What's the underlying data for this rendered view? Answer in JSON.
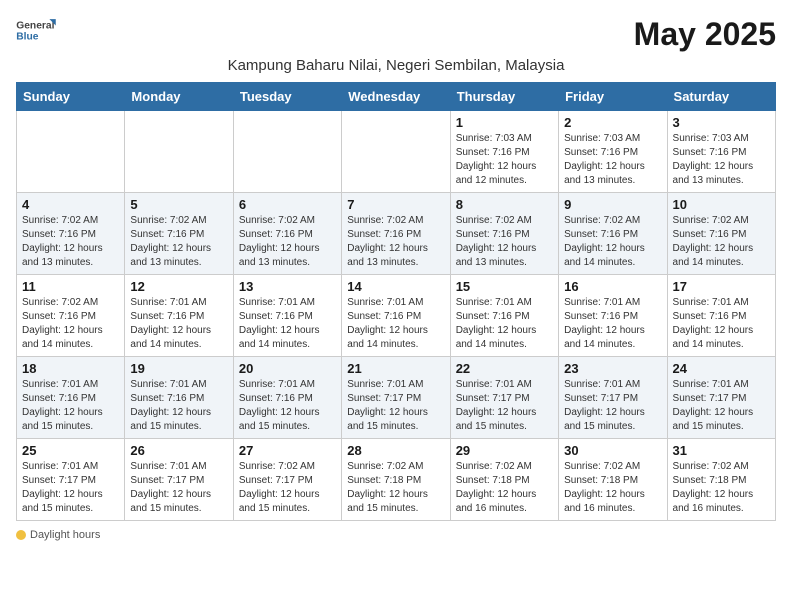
{
  "header": {
    "logo_general": "General",
    "logo_blue": "Blue",
    "month_title": "May 2025",
    "subtitle": "Kampung Baharu Nilai, Negeri Sembilan, Malaysia"
  },
  "days_of_week": [
    "Sunday",
    "Monday",
    "Tuesday",
    "Wednesday",
    "Thursday",
    "Friday",
    "Saturday"
  ],
  "weeks": [
    [
      {
        "day": "",
        "info": ""
      },
      {
        "day": "",
        "info": ""
      },
      {
        "day": "",
        "info": ""
      },
      {
        "day": "",
        "info": ""
      },
      {
        "day": "1",
        "info": "Sunrise: 7:03 AM\nSunset: 7:16 PM\nDaylight: 12 hours\nand 12 minutes."
      },
      {
        "day": "2",
        "info": "Sunrise: 7:03 AM\nSunset: 7:16 PM\nDaylight: 12 hours\nand 13 minutes."
      },
      {
        "day": "3",
        "info": "Sunrise: 7:03 AM\nSunset: 7:16 PM\nDaylight: 12 hours\nand 13 minutes."
      }
    ],
    [
      {
        "day": "4",
        "info": "Sunrise: 7:02 AM\nSunset: 7:16 PM\nDaylight: 12 hours\nand 13 minutes."
      },
      {
        "day": "5",
        "info": "Sunrise: 7:02 AM\nSunset: 7:16 PM\nDaylight: 12 hours\nand 13 minutes."
      },
      {
        "day": "6",
        "info": "Sunrise: 7:02 AM\nSunset: 7:16 PM\nDaylight: 12 hours\nand 13 minutes."
      },
      {
        "day": "7",
        "info": "Sunrise: 7:02 AM\nSunset: 7:16 PM\nDaylight: 12 hours\nand 13 minutes."
      },
      {
        "day": "8",
        "info": "Sunrise: 7:02 AM\nSunset: 7:16 PM\nDaylight: 12 hours\nand 13 minutes."
      },
      {
        "day": "9",
        "info": "Sunrise: 7:02 AM\nSunset: 7:16 PM\nDaylight: 12 hours\nand 14 minutes."
      },
      {
        "day": "10",
        "info": "Sunrise: 7:02 AM\nSunset: 7:16 PM\nDaylight: 12 hours\nand 14 minutes."
      }
    ],
    [
      {
        "day": "11",
        "info": "Sunrise: 7:02 AM\nSunset: 7:16 PM\nDaylight: 12 hours\nand 14 minutes."
      },
      {
        "day": "12",
        "info": "Sunrise: 7:01 AM\nSunset: 7:16 PM\nDaylight: 12 hours\nand 14 minutes."
      },
      {
        "day": "13",
        "info": "Sunrise: 7:01 AM\nSunset: 7:16 PM\nDaylight: 12 hours\nand 14 minutes."
      },
      {
        "day": "14",
        "info": "Sunrise: 7:01 AM\nSunset: 7:16 PM\nDaylight: 12 hours\nand 14 minutes."
      },
      {
        "day": "15",
        "info": "Sunrise: 7:01 AM\nSunset: 7:16 PM\nDaylight: 12 hours\nand 14 minutes."
      },
      {
        "day": "16",
        "info": "Sunrise: 7:01 AM\nSunset: 7:16 PM\nDaylight: 12 hours\nand 14 minutes."
      },
      {
        "day": "17",
        "info": "Sunrise: 7:01 AM\nSunset: 7:16 PM\nDaylight: 12 hours\nand 14 minutes."
      }
    ],
    [
      {
        "day": "18",
        "info": "Sunrise: 7:01 AM\nSunset: 7:16 PM\nDaylight: 12 hours\nand 15 minutes."
      },
      {
        "day": "19",
        "info": "Sunrise: 7:01 AM\nSunset: 7:16 PM\nDaylight: 12 hours\nand 15 minutes."
      },
      {
        "day": "20",
        "info": "Sunrise: 7:01 AM\nSunset: 7:16 PM\nDaylight: 12 hours\nand 15 minutes."
      },
      {
        "day": "21",
        "info": "Sunrise: 7:01 AM\nSunset: 7:17 PM\nDaylight: 12 hours\nand 15 minutes."
      },
      {
        "day": "22",
        "info": "Sunrise: 7:01 AM\nSunset: 7:17 PM\nDaylight: 12 hours\nand 15 minutes."
      },
      {
        "day": "23",
        "info": "Sunrise: 7:01 AM\nSunset: 7:17 PM\nDaylight: 12 hours\nand 15 minutes."
      },
      {
        "day": "24",
        "info": "Sunrise: 7:01 AM\nSunset: 7:17 PM\nDaylight: 12 hours\nand 15 minutes."
      }
    ],
    [
      {
        "day": "25",
        "info": "Sunrise: 7:01 AM\nSunset: 7:17 PM\nDaylight: 12 hours\nand 15 minutes."
      },
      {
        "day": "26",
        "info": "Sunrise: 7:01 AM\nSunset: 7:17 PM\nDaylight: 12 hours\nand 15 minutes."
      },
      {
        "day": "27",
        "info": "Sunrise: 7:02 AM\nSunset: 7:17 PM\nDaylight: 12 hours\nand 15 minutes."
      },
      {
        "day": "28",
        "info": "Sunrise: 7:02 AM\nSunset: 7:18 PM\nDaylight: 12 hours\nand 15 minutes."
      },
      {
        "day": "29",
        "info": "Sunrise: 7:02 AM\nSunset: 7:18 PM\nDaylight: 12 hours\nand 16 minutes."
      },
      {
        "day": "30",
        "info": "Sunrise: 7:02 AM\nSunset: 7:18 PM\nDaylight: 12 hours\nand 16 minutes."
      },
      {
        "day": "31",
        "info": "Sunrise: 7:02 AM\nSunset: 7:18 PM\nDaylight: 12 hours\nand 16 minutes."
      }
    ]
  ],
  "footer": {
    "daylight_label": "Daylight hours"
  }
}
